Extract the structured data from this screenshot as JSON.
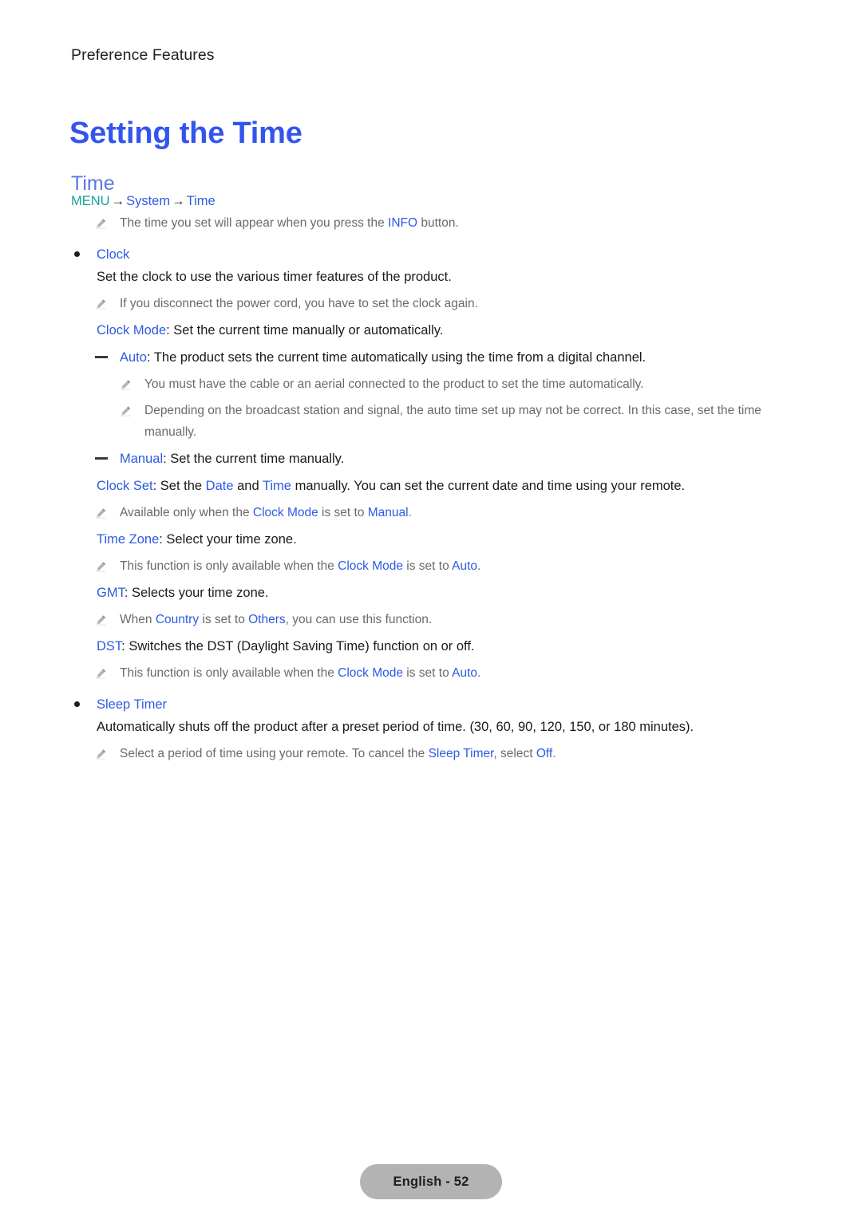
{
  "header": {
    "running_title": "Preference Features"
  },
  "titles": {
    "chapter": "Setting the Time",
    "section": "Time"
  },
  "colors": {
    "chapter_blue": "#3355ee",
    "section_blue": "#5b77ea",
    "link_blue": "#2d5be3",
    "menu_teal": "#17a398",
    "note_gray": "#6a6a6a",
    "footer_pill": "#b3b3b3"
  },
  "menu_path": {
    "root": "MENU",
    "arrow": "→",
    "level1": "System",
    "level2": "Time"
  },
  "lines": {
    "note_info_1": "The time you set will appear when you press the ",
    "note_info_link": "INFO",
    "note_info_2": " button.",
    "clock_label": "Clock",
    "clock_desc": "Set the clock to use the various timer features of the product.",
    "clock_note": "If you disconnect the power cord, you have to set the clock again.",
    "clock_mode_label": "Clock Mode",
    "clock_mode_desc": ": Set the current time manually or automatically.",
    "auto_label": "Auto",
    "auto_desc": ": The product sets the current time automatically using the time from a digital channel.",
    "auto_note_1": "You must have the cable or an aerial connected to the product to set the time automatically.",
    "auto_note_2": "Depending on the broadcast station and signal, the auto time set up may not be correct. In this case, set the time manually.",
    "manual_label": "Manual",
    "manual_desc": ": Set the current time manually.",
    "clock_set_label": "Clock Set",
    "clock_set_p1": ": Set the ",
    "clock_set_date": "Date",
    "clock_set_p2": " and ",
    "clock_set_time": "Time",
    "clock_set_p3": " manually. You can set the current date and time using your remote.",
    "clock_set_note_1": "Available only when the ",
    "clock_set_note_mode": "Clock Mode",
    "clock_set_note_2": " is set to ",
    "clock_set_note_manual": "Manual",
    "clock_set_note_3": ".",
    "time_zone_label": "Time Zone",
    "time_zone_desc": ": Select your time zone.",
    "time_zone_note_1": "This function is only available when the ",
    "time_zone_note_mode": "Clock Mode",
    "time_zone_note_2": " is set to ",
    "time_zone_note_auto": "Auto",
    "time_zone_note_3": ".",
    "gmt_label": "GMT",
    "gmt_desc": ": Selects your time zone.",
    "gmt_note_1": "When ",
    "gmt_note_country": "Country",
    "gmt_note_2": " is set to ",
    "gmt_note_others": "Others",
    "gmt_note_3": ", you can use this function.",
    "dst_label": "DST",
    "dst_desc": ": Switches the DST (Daylight Saving Time) function on or off.",
    "dst_note_1": "This function is only available when the ",
    "dst_note_mode": "Clock Mode",
    "dst_note_2": " is set to ",
    "dst_note_auto": "Auto",
    "dst_note_3": ".",
    "sleep_timer_label": "Sleep Timer",
    "sleep_timer_desc": "Automatically shuts off the product after a preset period of time. (30, 60, 90, 120, 150, or 180 minutes).",
    "sleep_timer_note_1": "Select a period of time using your remote. To cancel the ",
    "sleep_timer_note_link": "Sleep Timer",
    "sleep_timer_note_2": ", select ",
    "sleep_timer_note_off": "Off",
    "sleep_timer_note_3": "."
  },
  "footer": {
    "page_label": "English - 52"
  },
  "icons": {
    "note": "pencil-icon",
    "bullet": "bullet-icon",
    "dash": "dash-icon"
  }
}
